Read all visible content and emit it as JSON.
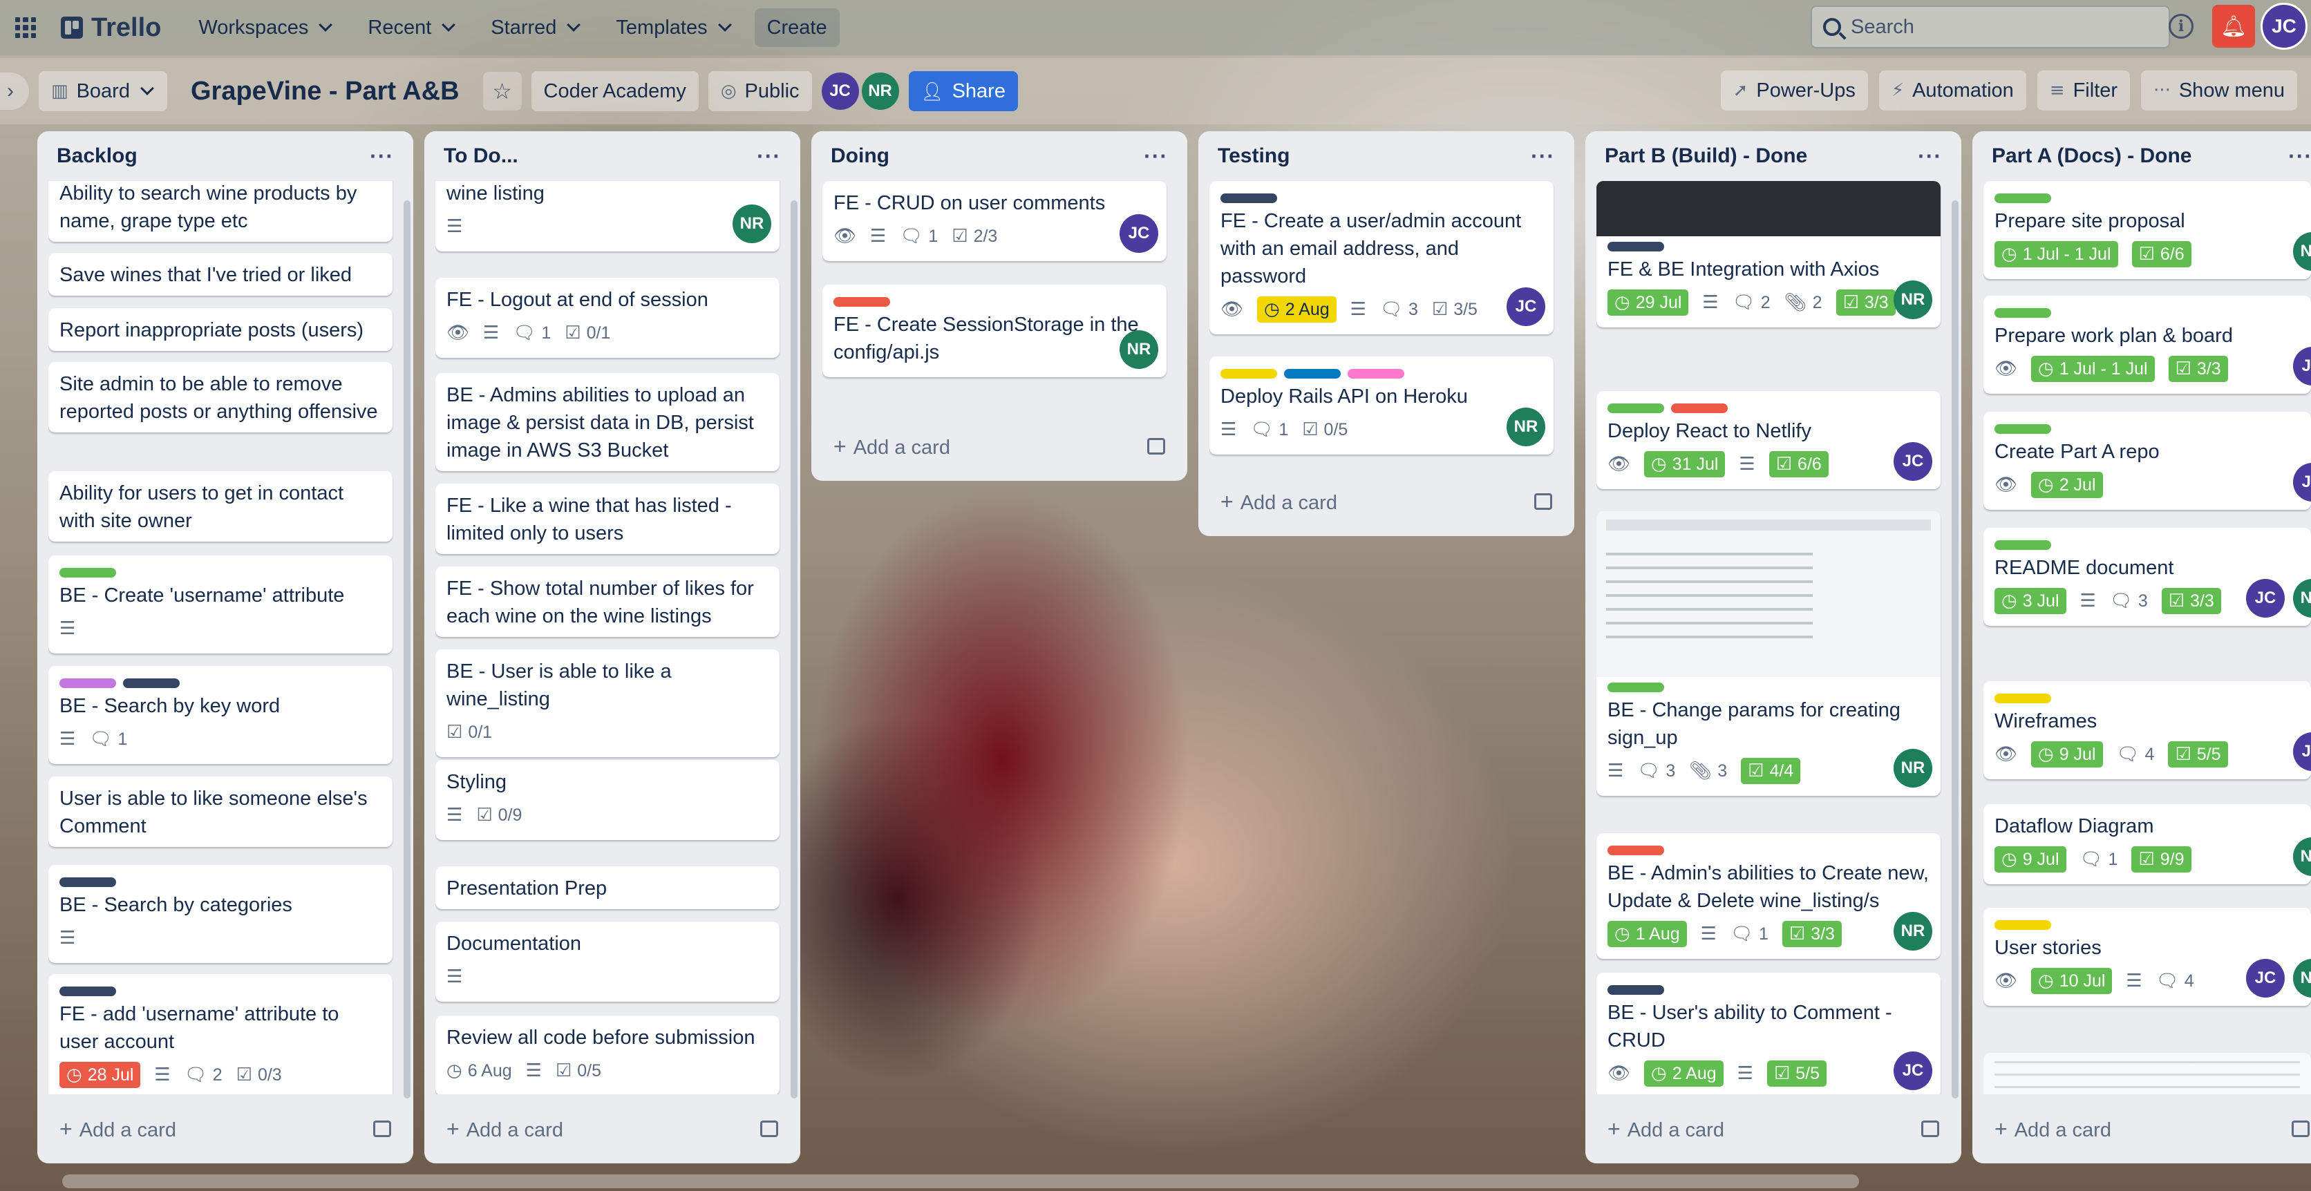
{
  "app": {
    "name": "Trello",
    "workspaces": "Workspaces",
    "recent": "Recent",
    "starred": "Starred",
    "templates": "Templates",
    "create": "Create",
    "search_placeholder": "Search",
    "user_initials": "JC"
  },
  "board": {
    "view": "Board",
    "title": "GrapeVine - Part A&B",
    "workspace": "Coder Academy",
    "visibility": "Public",
    "share": "Share",
    "power_ups": "Power-Ups",
    "automation": "Automation",
    "filter": "Filter",
    "show_menu": "Show menu",
    "members": [
      "JC",
      "NR"
    ]
  },
  "lists": [
    {
      "title": "Backlog",
      "add": "Add a card",
      "cards": [
        {
          "title": "Ability to search wine products by name, grape type etc"
        },
        {
          "title": "Save wines that I've tried or liked"
        },
        {
          "title": "Report inappropriate posts (users)"
        },
        {
          "title": "Site admin to be able to remove reported posts or anything offensive"
        },
        {
          "title": "Ability for users to get in contact with site owner"
        },
        {
          "title": "BE - Create 'username' attribute"
        },
        {
          "title": "BE - Search by key word",
          "comments": "1"
        },
        {
          "title": "User is able to like someone else's Comment"
        },
        {
          "title": "BE - Search by categories"
        },
        {
          "title": "FE - add 'username' attribute to user account",
          "date": "28 Jul",
          "comments": "2",
          "checklist": "0/3"
        }
      ]
    },
    {
      "title": "To Do...",
      "add": "Add a card",
      "cards": [
        {
          "title": "wine listing",
          "member": "NR"
        },
        {
          "title": "FE - Logout at end of session",
          "comments": "1",
          "checklist": "0/1"
        },
        {
          "title": "BE - Admins abilities to upload an image & persist data in DB, persist image in AWS S3 Bucket"
        },
        {
          "title": "FE - Like a wine that has listed - limited only to users"
        },
        {
          "title": "FE - Show total number of likes for each wine on the wine listings"
        },
        {
          "title": "BE - User is able to like a wine_listing",
          "checklist": "0/1"
        },
        {
          "title": "Styling",
          "checklist": "0/9"
        },
        {
          "title": "Presentation Prep"
        },
        {
          "title": "Documentation"
        },
        {
          "title": "Review all code before submission",
          "date": "6 Aug",
          "checklist": "0/5"
        }
      ]
    },
    {
      "title": "Doing",
      "add": "Add a card",
      "cards": [
        {
          "title": "FE - CRUD on user comments",
          "comments": "1",
          "checklist": "2/3",
          "member": "JC"
        },
        {
          "title": "FE - Create SessionStorage in the config/api.js",
          "member": "NR"
        }
      ]
    },
    {
      "title": "Testing",
      "add": "Add a card",
      "cards": [
        {
          "title": "FE - Create a user/admin account with an email address, and password",
          "date": "2 Aug",
          "comments": "3",
          "checklist": "3/5",
          "member": "JC"
        },
        {
          "title": "Deploy Rails API on Heroku",
          "comments": "1",
          "checklist": "0/5",
          "member": "NR"
        }
      ]
    },
    {
      "title": "Part B (Build) - Done",
      "add": "Add a card",
      "cards": [
        {
          "title": "FE & BE Integration with Axios",
          "date": "29 Jul",
          "comments": "2",
          "attachments": "2",
          "checklist": "3/3",
          "member": "NR"
        },
        {
          "title": "Deploy React to Netlify",
          "date": "31 Jul",
          "checklist": "6/6",
          "member": "JC"
        },
        {
          "title": "BE - Change params for creating sign_up",
          "comments": "3",
          "attachments": "3",
          "checklist": "4/4",
          "member": "NR"
        },
        {
          "title": "BE - Admin's abilities to Create new, Update & Delete wine_listing/s",
          "date": "1 Aug",
          "comments": "1",
          "checklist": "3/3",
          "member": "NR"
        },
        {
          "title": "BE - User's ability to Comment - CRUD",
          "date": "2 Aug",
          "checklist": "5/5",
          "member": "JC"
        }
      ]
    },
    {
      "title": "Part A (Docs) - Done",
      "add": "Add a card",
      "cards": [
        {
          "title": "Prepare site proposal",
          "date": "1 Jul - 1 Jul",
          "checklist": "6/6"
        },
        {
          "title": "Prepare work plan & board",
          "date": "1 Jul - 1 Jul",
          "checklist": "3/3"
        },
        {
          "title": "Create Part A repo",
          "date": "2 Jul"
        },
        {
          "title": "README document",
          "date": "3 Jul",
          "comments": "3",
          "checklist": "3/3"
        },
        {
          "title": "Wireframes",
          "date": "9 Jul",
          "comments": "4",
          "checklist": "5/5"
        },
        {
          "title": "Dataflow Diagram",
          "date": "9 Jul",
          "comments": "1",
          "checklist": "9/9"
        },
        {
          "title": "User stories",
          "date": "10 Jul",
          "comments": "4"
        }
      ]
    }
  ],
  "label_colors": {
    "green": "#61bd4f",
    "red": "#eb5a46",
    "yellow": "#f2d600",
    "purple": "#c377e0",
    "navy": "#344563",
    "blue": "#0079bf",
    "pink": "#ff78cb"
  }
}
